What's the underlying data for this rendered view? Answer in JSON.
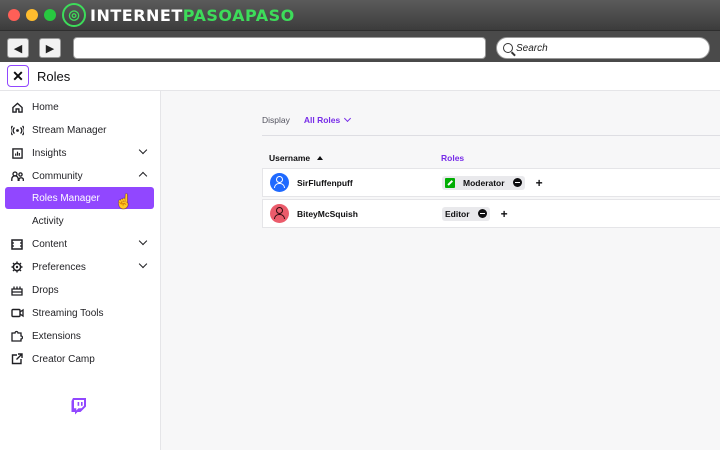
{
  "browser": {
    "brand_prefix": "INTERNET",
    "brand_accent": "PASOAPASO",
    "search_label": "Search",
    "url_value": ""
  },
  "header": {
    "title": "Roles"
  },
  "sidebar": {
    "items": [
      {
        "label": "Home",
        "icon": "home-icon"
      },
      {
        "label": "Stream Manager",
        "icon": "broadcast-icon"
      },
      {
        "label": "Insights",
        "icon": "insights-icon",
        "expandable": true
      },
      {
        "label": "Community",
        "icon": "community-icon",
        "expanded": true
      },
      {
        "label": "Roles Manager",
        "active": true
      },
      {
        "label": "Activity"
      },
      {
        "label": "Content",
        "icon": "content-icon",
        "expandable": true
      },
      {
        "label": "Preferences",
        "icon": "gear-icon",
        "expandable": true
      },
      {
        "label": "Drops",
        "icon": "drops-icon"
      },
      {
        "label": "Streaming Tools",
        "icon": "camera-icon"
      },
      {
        "label": "Extensions",
        "icon": "puzzle-icon"
      },
      {
        "label": "Creator Camp",
        "icon": "external-link-icon"
      }
    ]
  },
  "main": {
    "display_label": "Display",
    "display_value": "All Roles",
    "columns": {
      "username": "Username",
      "roles": "Roles"
    },
    "rows": [
      {
        "username": "SirFluffenpuff",
        "role": "Moderator",
        "avatar_color": "#1e69ff"
      },
      {
        "username": "BiteyMcSquish",
        "role": "Editor",
        "avatar_color": "#eb5b6b"
      }
    ]
  },
  "colors": {
    "accent": "#9147ff",
    "moderator": "#00ad03"
  }
}
